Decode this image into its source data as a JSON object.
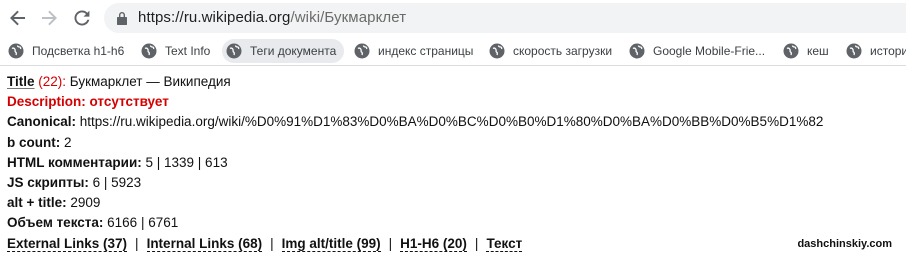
{
  "browser": {
    "url_host": "https://ru.wikipedia.org",
    "url_path": "/wiki/Букмарклет",
    "icons": {
      "back": "arrow-left-icon",
      "forward": "arrow-right-icon",
      "reload": "reload-icon",
      "lock": "lock-icon",
      "bookmark": "globe-icon"
    }
  },
  "bookmarks": [
    {
      "label": "Подсветка h1-h6"
    },
    {
      "label": "Text Info"
    },
    {
      "label": "Теги документа"
    },
    {
      "label": "индекс страницы"
    },
    {
      "label": "скорость загрузки"
    },
    {
      "label": "Google Mobile-Frie..."
    },
    {
      "label": "кеш"
    },
    {
      "label": "истори"
    }
  ],
  "report": {
    "title_label": "Title",
    "title_count": " (22):",
    "title_value": " Букмарклет — Википедия",
    "description_label": "Description:",
    "description_value": " отсутствует",
    "canonical_label": "Canonical:",
    "canonical_value": " https://ru.wikipedia.org/wiki/%D0%91%D1%83%D0%BA%D0%BC%D0%B0%D1%80%D0%BA%D0%BB%D0%B5%D1%82",
    "bcount_label": "b count:",
    "bcount_value": " 2",
    "html_comments_label": "HTML комментарии:",
    "html_comments_value": " 5 | 1339 | 613",
    "js_label": "JS скрипты:",
    "js_value": " 6 | 5923",
    "alt_title_label": "alt + title:",
    "alt_title_value": " 2909",
    "text_volume_label": "Объем текста:",
    "text_volume_value": " 6166 | 6761",
    "links": {
      "external": "External Links (37)",
      "internal": "Internal Links (68)",
      "img_alt": "Img alt/title (99)",
      "headings": "H1-H6 (20)",
      "text": "Текст",
      "separator": "|"
    }
  },
  "watermark": "dashchinskiy.com"
}
